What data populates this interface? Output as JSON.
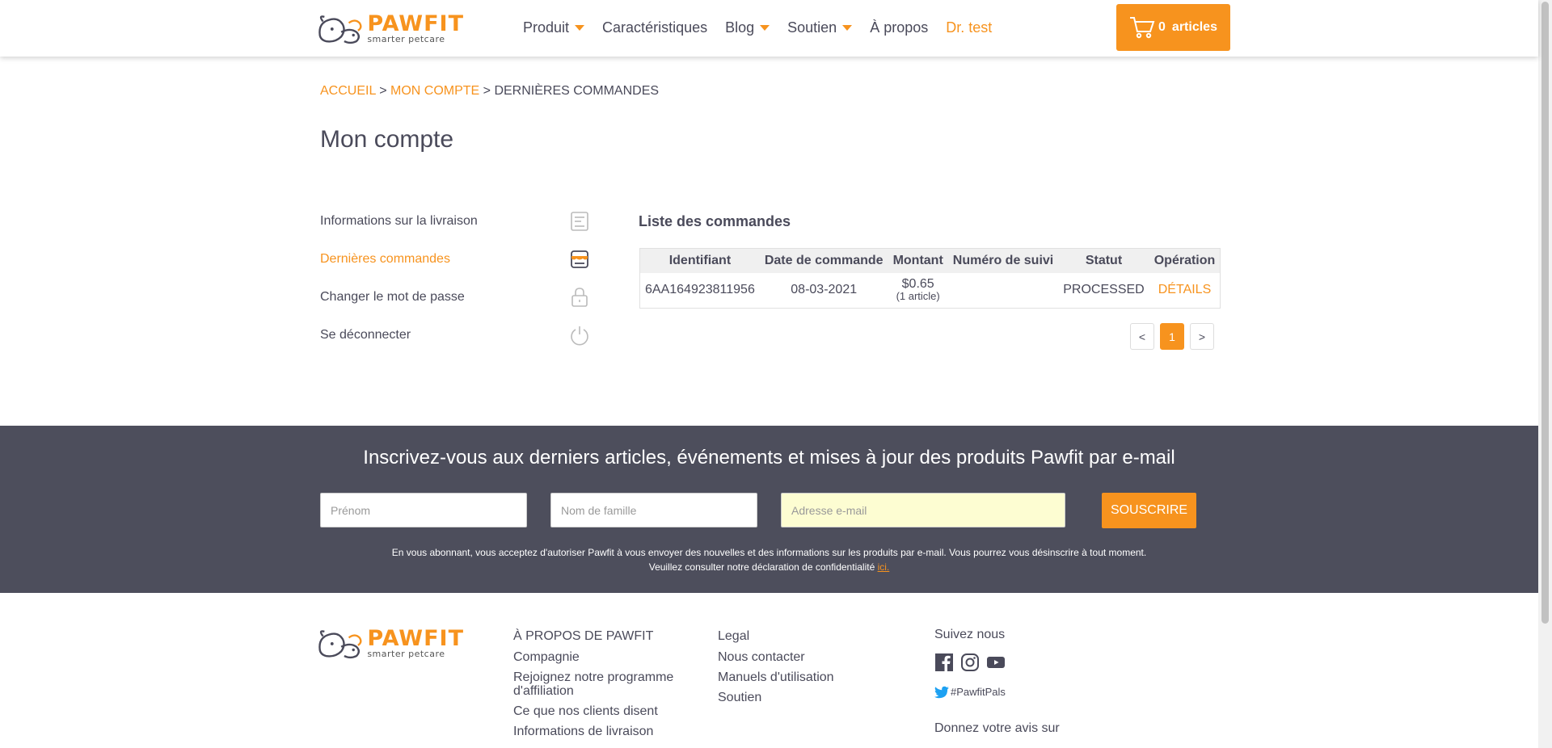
{
  "header": {
    "logo": {
      "name": "PAWFIT",
      "tagline": "smarter petcare"
    },
    "nav": [
      {
        "label": "Produit",
        "dropdown": true
      },
      {
        "label": "Caractéristiques",
        "dropdown": false
      },
      {
        "label": "Blog",
        "dropdown": true
      },
      {
        "label": "Soutien",
        "dropdown": true
      },
      {
        "label": "À propos",
        "dropdown": false
      },
      {
        "label": "Dr. test",
        "dropdown": false
      }
    ],
    "cart": {
      "count": "0",
      "label": "articles"
    }
  },
  "breadcrumb": {
    "home": "ACCUEIL",
    "sep1": " > ",
    "account": "MON COMPTE",
    "sep2": " > ",
    "current": "DERNIÈRES COMMANDES"
  },
  "page_title": "Mon compte",
  "sidebar": {
    "items": [
      {
        "label": "Informations sur la livraison",
        "icon": "receipt-icon"
      },
      {
        "label": "Dernières commandes",
        "icon": "store-icon",
        "active": true
      },
      {
        "label": "Changer le mot de passe",
        "icon": "lock-icon"
      },
      {
        "label": "Se déconnecter",
        "icon": "power-icon"
      }
    ]
  },
  "orders": {
    "title": "Liste des commandes",
    "columns": [
      "Identifiant",
      "Date de commande",
      "Montant",
      "Numéro de suivi",
      "Statut",
      "Opération"
    ],
    "rows": [
      {
        "id": "6AA164923811956",
        "date": "08-03-2021",
        "amount": "$0.65",
        "items": "(1 article)",
        "tracking": "",
        "status": "PROCESSED",
        "operation": "DÉTAILS"
      }
    ],
    "pager": {
      "prev": "<",
      "current": "1",
      "next": ">"
    }
  },
  "newsletter": {
    "title": "Inscrivez-vous aux derniers articles, événements et mises à jour des produits Pawfit par e-mail",
    "first_name_placeholder": "Prénom",
    "last_name_placeholder": "Nom de famille",
    "email_placeholder": "Adresse e-mail",
    "button": "SOUSCRIRE",
    "note_line1": "En vous abonnant, vous acceptez d'autoriser Pawfit à vous envoyer des nouvelles et des informations sur les produits par e-mail. Vous pourrez vous désinscrire à tout moment.",
    "note_line2": "Veuillez consulter notre déclaration de confidentialité ",
    "note_link": "ici."
  },
  "footer": {
    "col1": [
      "À PROPOS DE PAWFIT",
      "Compagnie",
      "Rejoignez notre programme d'affiliation",
      "Ce que nos clients disent",
      "Informations de livraison"
    ],
    "col2": [
      "Legal",
      "Nous contacter",
      "Manuels d'utilisation",
      "Soutien"
    ],
    "follow": {
      "title": "Suivez nous",
      "hashtag": "#PawfitPals",
      "feedback": "Donnez votre avis sur"
    }
  },
  "colors": {
    "accent": "#f7931e",
    "text": "#4a4a5a",
    "newsletter_bg": "#4d4e5c"
  }
}
